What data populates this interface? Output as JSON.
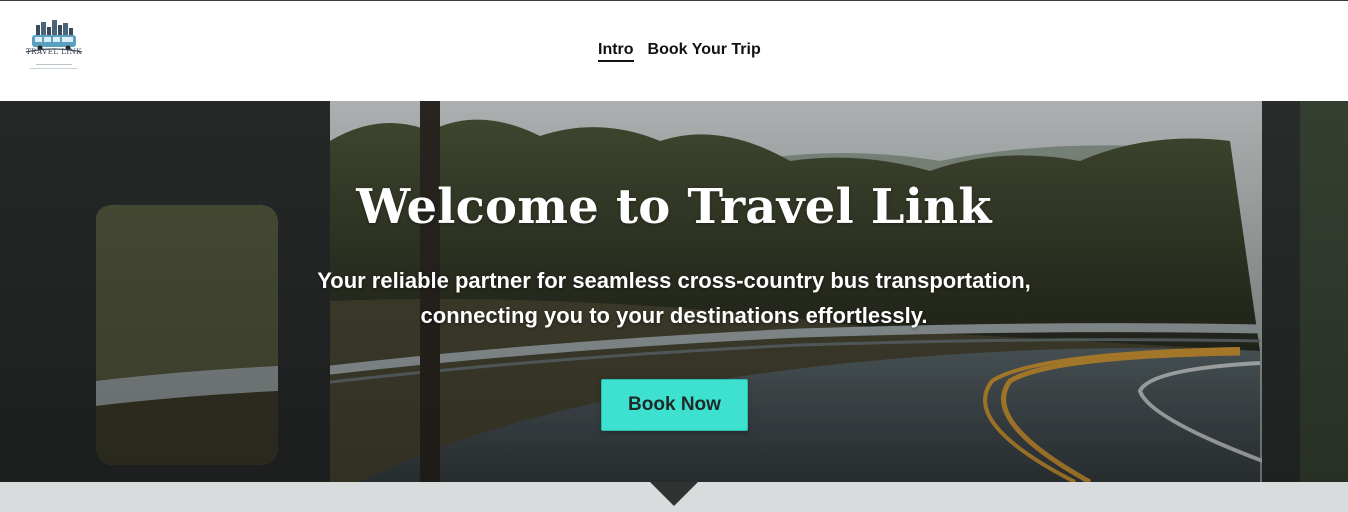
{
  "brand": {
    "logo_icon": "travel-link-bus-logo-icon",
    "logo_text": "TRAVEL LINK"
  },
  "nav": {
    "items": [
      {
        "label": "Intro",
        "active": true
      },
      {
        "label": "Book Your Trip",
        "active": false
      }
    ]
  },
  "hero": {
    "title": "Welcome to Travel Link",
    "subtitle": "Your reliable partner for seamless cross-country bus transportation, connecting you to your destinations effortlessly.",
    "cta_label": "Book Now"
  },
  "colors": {
    "accent": "#3ee0cf",
    "section_below": "#d9dcdc",
    "header_bg": "#ffffff"
  }
}
